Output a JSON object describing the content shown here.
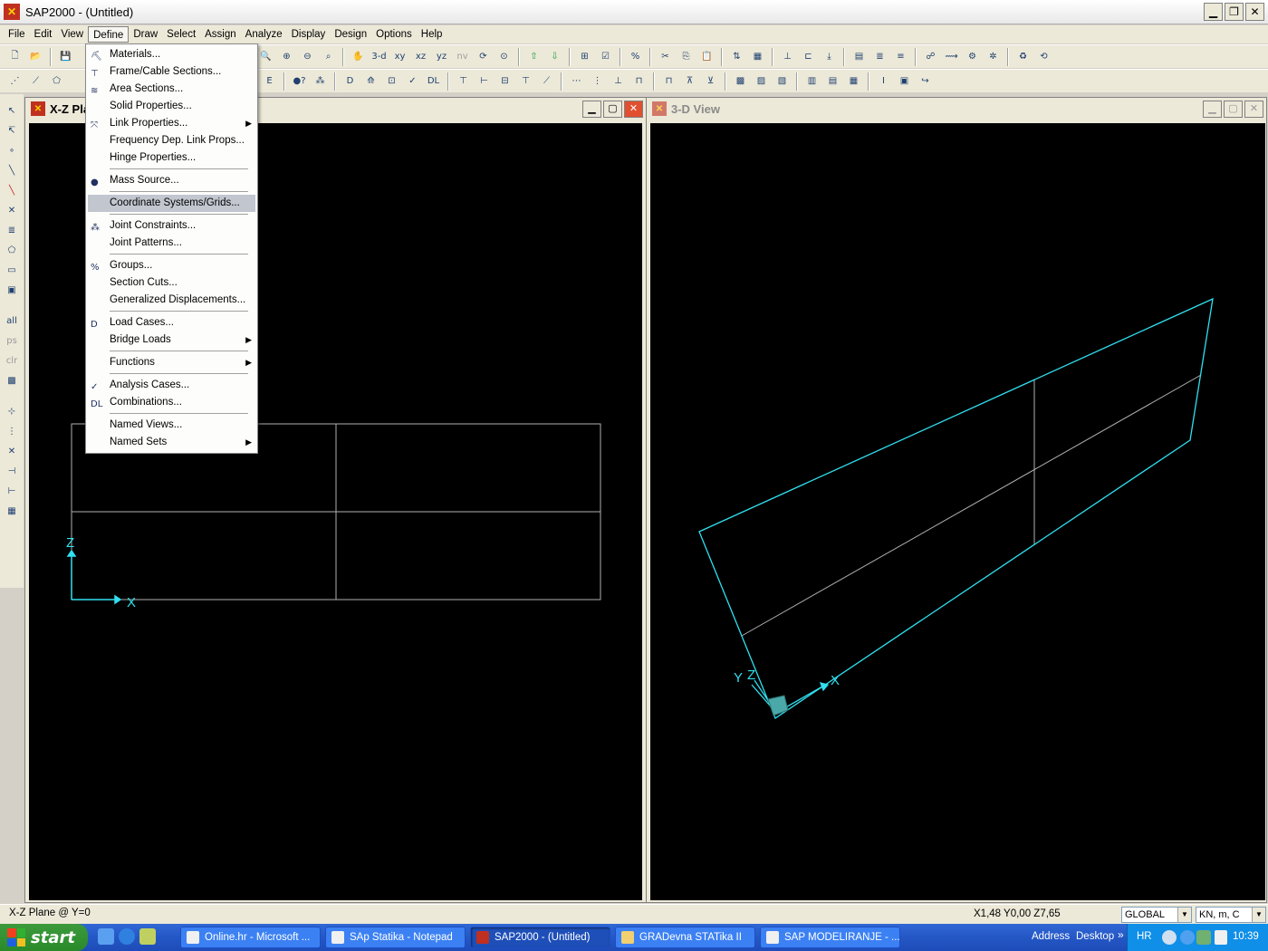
{
  "window": {
    "title": "SAP2000 - (Untitled)",
    "app_icon": "sap2000-logo-icon",
    "minimize": "0",
    "maximize": "1",
    "close": "r"
  },
  "menubar": {
    "items": [
      "File",
      "Edit",
      "View",
      "Define",
      "Draw",
      "Select",
      "Assign",
      "Analyze",
      "Display",
      "Design",
      "Options",
      "Help"
    ],
    "active": "Define"
  },
  "toolbar": {
    "view_buttons": [
      "3-d",
      "xy",
      "xz",
      "yz",
      "nv"
    ]
  },
  "define_menu": {
    "items": [
      {
        "label": "Materials...",
        "icon": "materials-icon"
      },
      {
        "label": "Frame/Cable Sections...",
        "icon": "frame-sections-icon"
      },
      {
        "label": "Area Sections...",
        "icon": "area-sections-icon"
      },
      {
        "label": "Solid Properties...",
        "icon": ""
      },
      {
        "label": "Link Properties...",
        "icon": "link-properties-icon",
        "submenu": true
      },
      {
        "label": "Frequency Dep. Link Props...",
        "icon": ""
      },
      {
        "label": "Hinge Properties...",
        "icon": ""
      },
      {
        "sep": true
      },
      {
        "label": "Mass  Source...",
        "icon": "mass-source-icon"
      },
      {
        "sep": true
      },
      {
        "label": "Coordinate Systems/Grids...",
        "icon": "",
        "highlighted": true
      },
      {
        "sep": true
      },
      {
        "label": "Joint Constraints...",
        "icon": "joint-constraints-icon"
      },
      {
        "label": "Joint Patterns...",
        "icon": ""
      },
      {
        "sep": true
      },
      {
        "label": "Groups...",
        "icon": "groups-icon"
      },
      {
        "label": "Section Cuts...",
        "icon": ""
      },
      {
        "label": "Generalized Displacements...",
        "icon": ""
      },
      {
        "sep": true
      },
      {
        "label": "Load Cases...",
        "icon": "load-cases-icon"
      },
      {
        "label": "Bridge Loads",
        "icon": "",
        "submenu": true
      },
      {
        "sep": true
      },
      {
        "label": "Functions",
        "icon": "",
        "submenu": true
      },
      {
        "sep": true
      },
      {
        "label": "Analysis Cases...",
        "icon": "analysis-cases-icon"
      },
      {
        "label": "Combinations...",
        "icon": "combinations-icon"
      },
      {
        "sep": true
      },
      {
        "label": "Named Views...",
        "icon": ""
      },
      {
        "label": "Named Sets",
        "icon": "",
        "submenu": true
      }
    ]
  },
  "xz_window": {
    "title": "X-Z Pla",
    "axis_x": "X",
    "axis_z": "Z"
  },
  "view3d_window": {
    "title": "3-D View",
    "axis_x": "X",
    "axis_y": "Y",
    "axis_z": "Z"
  },
  "statusbar": {
    "left": "X-Z Plane @ Y=0",
    "coords": "X1,48  Y0,00  Z7,65",
    "coord_system": "GLOBAL",
    "units": "KN, m, C"
  },
  "taskbar": {
    "start": "start",
    "tasks": [
      {
        "label": "Online.hr - Microsoft ...",
        "active": false
      },
      {
        "label": "SAp Statika - Notepad",
        "active": false
      },
      {
        "label": "SAP2000 - (Untitled)",
        "active": true
      },
      {
        "label": "GRADevna  STATika  II",
        "active": false
      },
      {
        "label": "SAP  MODELIRANJE - ...",
        "active": false
      }
    ],
    "address": "Address",
    "desktop": "Desktop",
    "language": "HR",
    "clock": "10:39"
  },
  "colors": {
    "canvas_bg": "#000000",
    "axis_color": "#30e0f0",
    "grid_color": "#b0b0b0",
    "menu_highlight": "#c1c6cf"
  }
}
